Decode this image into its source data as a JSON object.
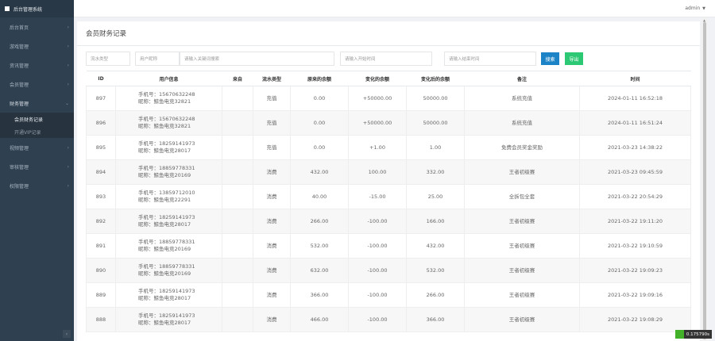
{
  "app": {
    "title": "后台管理系统"
  },
  "header": {
    "user": "admin",
    "caret": "▼"
  },
  "sidebar": {
    "items": [
      {
        "label": "后台首页"
      },
      {
        "label": "游戏管理"
      },
      {
        "label": "资讯管理"
      },
      {
        "label": "会员管理"
      },
      {
        "label": "财务管理"
      },
      {
        "label": "视频管理"
      },
      {
        "label": "审核管理"
      },
      {
        "label": "权限管理"
      }
    ],
    "sub_items": [
      {
        "label": "会员财务记录"
      },
      {
        "label": "开通VIP记录"
      }
    ],
    "collapse_icon": "‹"
  },
  "page": {
    "title": "会员财务记录"
  },
  "filters": {
    "type_label": "流水类型",
    "user_label": "用户昵称",
    "keyword_placeholder": "请输入关键词搜索",
    "start_placeholder": "请输入开始时间",
    "end_placeholder": "请输入结束时间",
    "search_label": "搜索",
    "export_label": "导出"
  },
  "table": {
    "columns": [
      "ID",
      "用户信息",
      "来自",
      "流水类型",
      "原来的余额",
      "变化的余额",
      "变化后的余额",
      "备注",
      "时间"
    ],
    "rows": [
      {
        "id": "897",
        "phone": "手机号：15670632248",
        "nick": "昵称：鲸鱼电竞32821",
        "from": "",
        "type": "充值",
        "before": "0.00",
        "change": "+50000.00",
        "after": "50000.00",
        "note": "系统充值",
        "time": "2024-01-11 16:52:18"
      },
      {
        "id": "896",
        "phone": "手机号：15670632248",
        "nick": "昵称：鲸鱼电竞32821",
        "from": "",
        "type": "充值",
        "before": "0.00",
        "change": "+50000.00",
        "after": "50000.00",
        "note": "系统充值",
        "time": "2024-01-11 16:51:24"
      },
      {
        "id": "895",
        "phone": "手机号：18259141973",
        "nick": "昵称：鲸鱼电竞28017",
        "from": "",
        "type": "充值",
        "before": "0.00",
        "change": "+1.00",
        "after": "1.00",
        "note": "免费会员奖金奖励",
        "time": "2021-03-23 14:38:22"
      },
      {
        "id": "894",
        "phone": "手机号：18859778331",
        "nick": "昵称：鲸鱼电竞20169",
        "from": "",
        "type": "消费",
        "before": "432.00",
        "change": "100.00",
        "after": "332.00",
        "note": "王者初级赛",
        "time": "2021-03-23 09:45:59"
      },
      {
        "id": "893",
        "phone": "手机号：13859712010",
        "nick": "昵称：鲸鱼电竞22291",
        "from": "",
        "type": "消费",
        "before": "40.00",
        "change": "-15.00",
        "after": "25.00",
        "note": "全拆包全套",
        "time": "2021-03-22 20:54:29"
      },
      {
        "id": "892",
        "phone": "手机号：18259141973",
        "nick": "昵称：鲸鱼电竞28017",
        "from": "",
        "type": "消费",
        "before": "266.00",
        "change": "-100.00",
        "after": "166.00",
        "note": "王者初级赛",
        "time": "2021-03-22 19:11:20"
      },
      {
        "id": "891",
        "phone": "手机号：18859778331",
        "nick": "昵称：鲸鱼电竞20169",
        "from": "",
        "type": "消费",
        "before": "532.00",
        "change": "-100.00",
        "after": "432.00",
        "note": "王者初级赛",
        "time": "2021-03-22 19:10:59"
      },
      {
        "id": "890",
        "phone": "手机号：18859778331",
        "nick": "昵称：鲸鱼电竞20169",
        "from": "",
        "type": "消费",
        "before": "632.00",
        "change": "-100.00",
        "after": "532.00",
        "note": "王者初级赛",
        "time": "2021-03-22 19:09:23"
      },
      {
        "id": "889",
        "phone": "手机号：18259141973",
        "nick": "昵称：鲸鱼电竞28017",
        "from": "",
        "type": "消费",
        "before": "366.00",
        "change": "-100.00",
        "after": "266.00",
        "note": "王者初级赛",
        "time": "2021-03-22 19:09:16"
      },
      {
        "id": "888",
        "phone": "手机号：18259141973",
        "nick": "昵称：鲸鱼电竞28017",
        "from": "",
        "type": "消费",
        "before": "466.00",
        "change": "-100.00",
        "after": "366.00",
        "note": "王者初级赛",
        "time": "2021-03-22 19:08:29"
      }
    ]
  },
  "badge": {
    "text": "0.175790s"
  }
}
